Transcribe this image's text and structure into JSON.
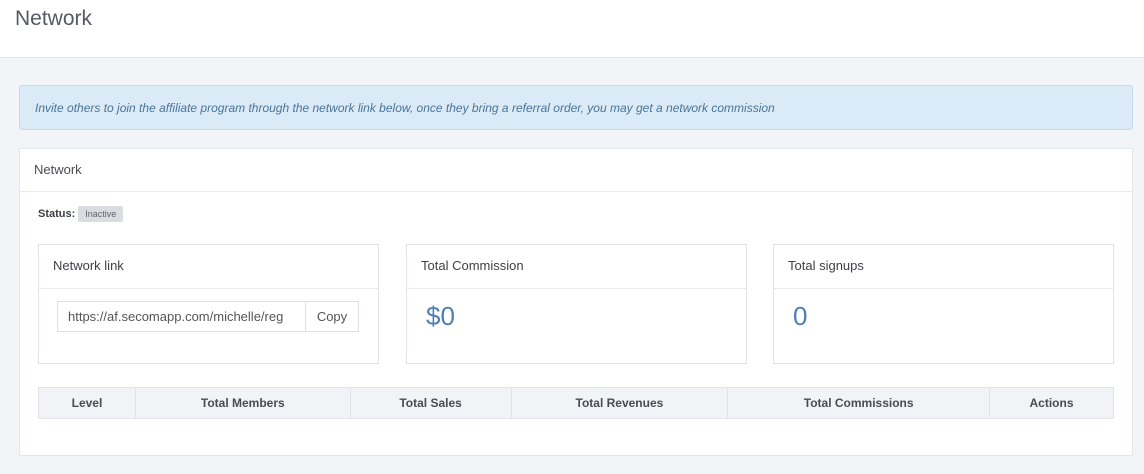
{
  "page": {
    "title": "Network"
  },
  "banner": {
    "text": "Invite others to join the affiliate program through the network link below, once they bring a referral order, you may get a network commission"
  },
  "portlet": {
    "title": "Network",
    "status_label": "Status:",
    "status_value": "Inactive"
  },
  "cards": {
    "network_link": {
      "title": "Network link",
      "url": "https://af.secomapp.com/michelle/reg",
      "copy_label": "Copy"
    },
    "total_commission": {
      "title": "Total Commission",
      "value": "$0"
    },
    "total_signups": {
      "title": "Total signups",
      "value": "0"
    }
  },
  "table": {
    "columns": [
      "Level",
      "Total Members",
      "Total Sales",
      "Total Revenues",
      "Total Commissions",
      "Actions"
    ]
  },
  "colors": {
    "accent_value": "#4f7fb5",
    "banner_bg": "#daeaf6",
    "banner_text": "#4b7497",
    "badge_bg": "#d9dce1"
  }
}
